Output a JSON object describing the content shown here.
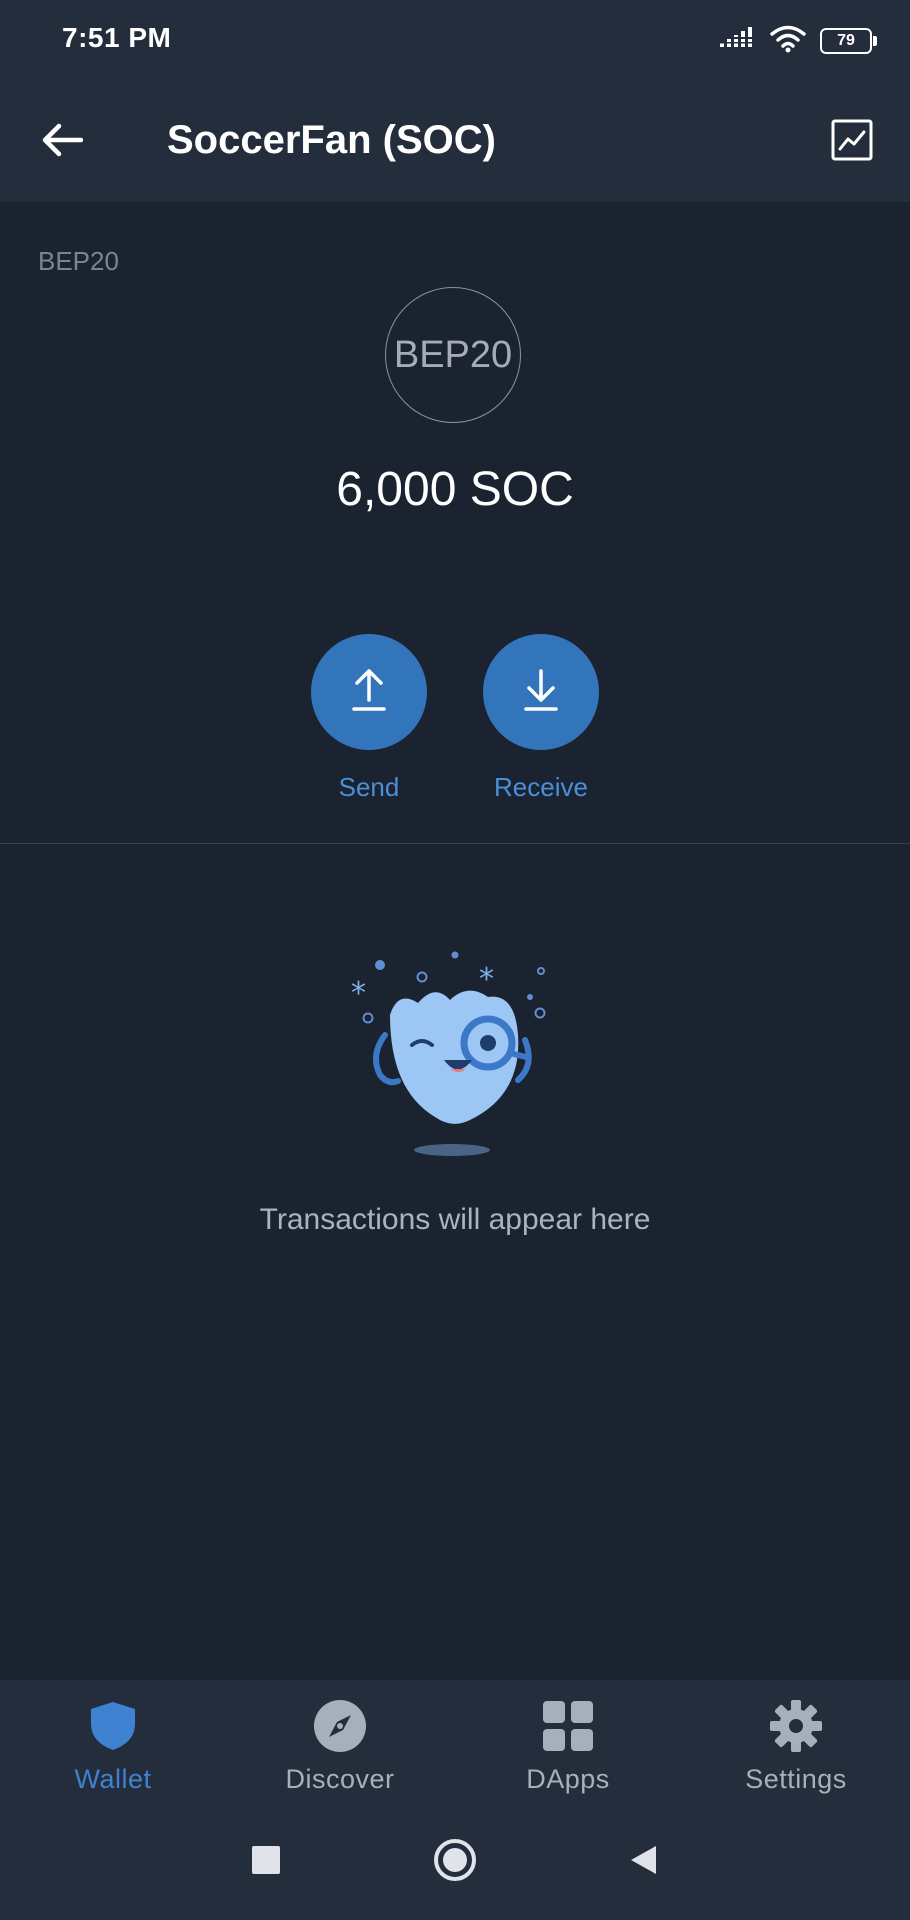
{
  "status_bar": {
    "time": "7:51 PM",
    "battery_level": "79",
    "icons": [
      "signal-icon",
      "wifi-icon",
      "battery-icon"
    ]
  },
  "app_bar": {
    "title": "SoccerFan (SOC)",
    "back_icon": "arrow-left-icon",
    "chart_icon": "chart-line-icon"
  },
  "token": {
    "network": "BEP20",
    "logo_text": "BEP20",
    "balance": "6,000 SOC"
  },
  "actions": [
    {
      "label": "Send",
      "icon": "arrow-up-icon"
    },
    {
      "label": "Receive",
      "icon": "arrow-down-icon"
    }
  ],
  "empty_state": {
    "message": "Transactions will appear here",
    "illustration": "mascot-magnifier-illustration"
  },
  "bottom_nav": {
    "items": [
      {
        "label": "Wallet",
        "icon": "shield-icon",
        "active": true
      },
      {
        "label": "Discover",
        "icon": "compass-icon",
        "active": false
      },
      {
        "label": "DApps",
        "icon": "grid-icon",
        "active": false
      },
      {
        "label": "Settings",
        "icon": "gear-icon",
        "active": false
      }
    ]
  },
  "system_nav": [
    "recents-square-icon",
    "home-circle-icon",
    "back-triangle-icon"
  ],
  "colors": {
    "background": "#1b2230",
    "bar_background": "#242d3b",
    "accent": "#3375bb",
    "accent_text": "#4b8fd8",
    "muted_text": "#a9b3c2"
  }
}
